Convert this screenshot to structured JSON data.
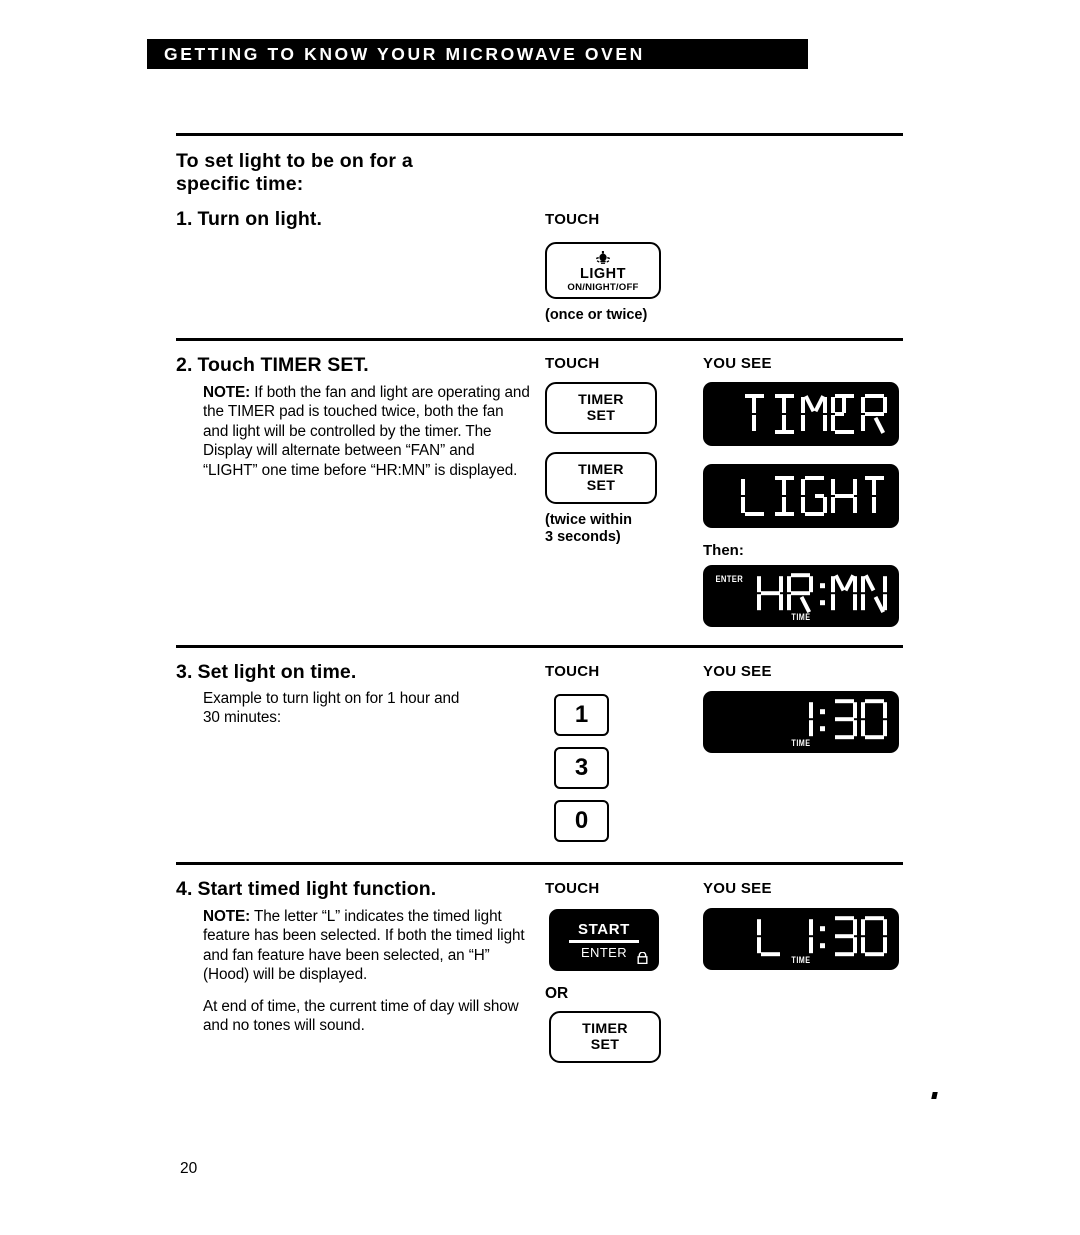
{
  "header": {
    "banner_title": "GETTING TO KNOW YOUR MICROWAVE OVEN"
  },
  "page": {
    "number": "20"
  },
  "intro": {
    "title_line1": "To set light to be on for a",
    "title_line2": "specific time:"
  },
  "columns": {
    "touch": "TOUCH",
    "you_see": "YOU SEE",
    "then": "Then:",
    "or": "OR"
  },
  "steps": [
    {
      "number": "1.",
      "title": "Turn on light.",
      "touch_label": "TOUCH",
      "buttons": [
        {
          "kind": "light-key",
          "icon": "light-bulb-icon",
          "line1": "LIGHT",
          "line2": "ON/NIGHT/OFF"
        }
      ],
      "button_note": "(once or twice)"
    },
    {
      "number": "2.",
      "title": "Touch TIMER SET.",
      "note_bold": "NOTE:",
      "note_text": " If both the fan and light are operating and the TIMER pad is touched twice, both the fan and light will be controlled by the timer. The Display will alternate between “FAN” and “LIGHT” one time before “HR:MN” is displayed.",
      "touch_label": "TOUCH",
      "you_see_label": "YOU SEE",
      "buttons": [
        {
          "kind": "timer-key",
          "line1": "TIMER",
          "line2": "SET"
        },
        {
          "kind": "timer-key",
          "line1": "TIMER",
          "line2": "SET"
        }
      ],
      "button_note_line1": "(twice within",
      "button_note_line2": "3 seconds)",
      "displays": [
        {
          "text": "TIMER",
          "sub": "",
          "enter": ""
        },
        {
          "text": "LIGHT",
          "sub": "",
          "enter": ""
        },
        {
          "text": "HR:MN",
          "sub": "TIME",
          "enter": "ENTER"
        }
      ]
    },
    {
      "number": "3.",
      "title": "Set light on time.",
      "body_line1": "Example to turn light on for 1 hour and",
      "body_line2": "30 minutes:",
      "touch_label": "TOUCH",
      "you_see_label": "YOU SEE",
      "buttons": [
        {
          "kind": "num-key",
          "label": "1"
        },
        {
          "kind": "num-key",
          "label": "3"
        },
        {
          "kind": "num-key",
          "label": "0"
        }
      ],
      "displays": [
        {
          "text": "1:30",
          "sub": "TIME",
          "enter": ""
        }
      ]
    },
    {
      "number": "4.",
      "title": "Start timed light function.",
      "note_bold": "NOTE:",
      "note_text": " The letter “L” indicates the timed light feature has been selected. If both the timed light and fan feature have been selected, an “H” (Hood) will be displayed.",
      "note_text2": "At end of time, the current time of day will show and no tones will sound.",
      "touch_label": "TOUCH",
      "you_see_label": "YOU SEE",
      "buttons": [
        {
          "kind": "start-key",
          "line1": "START",
          "line2": "ENTER",
          "icon": "lock-icon"
        },
        {
          "kind": "timer-key",
          "line1": "TIMER",
          "line2": "SET"
        }
      ],
      "or_label": "OR",
      "displays": [
        {
          "text": "L 1:30",
          "sub": "TIME",
          "enter": ""
        }
      ]
    }
  ],
  "colors": {
    "ink": "#000000",
    "paper": "#ffffff",
    "lcd_bg": "#000000",
    "lcd_fg": "#ffffff"
  }
}
